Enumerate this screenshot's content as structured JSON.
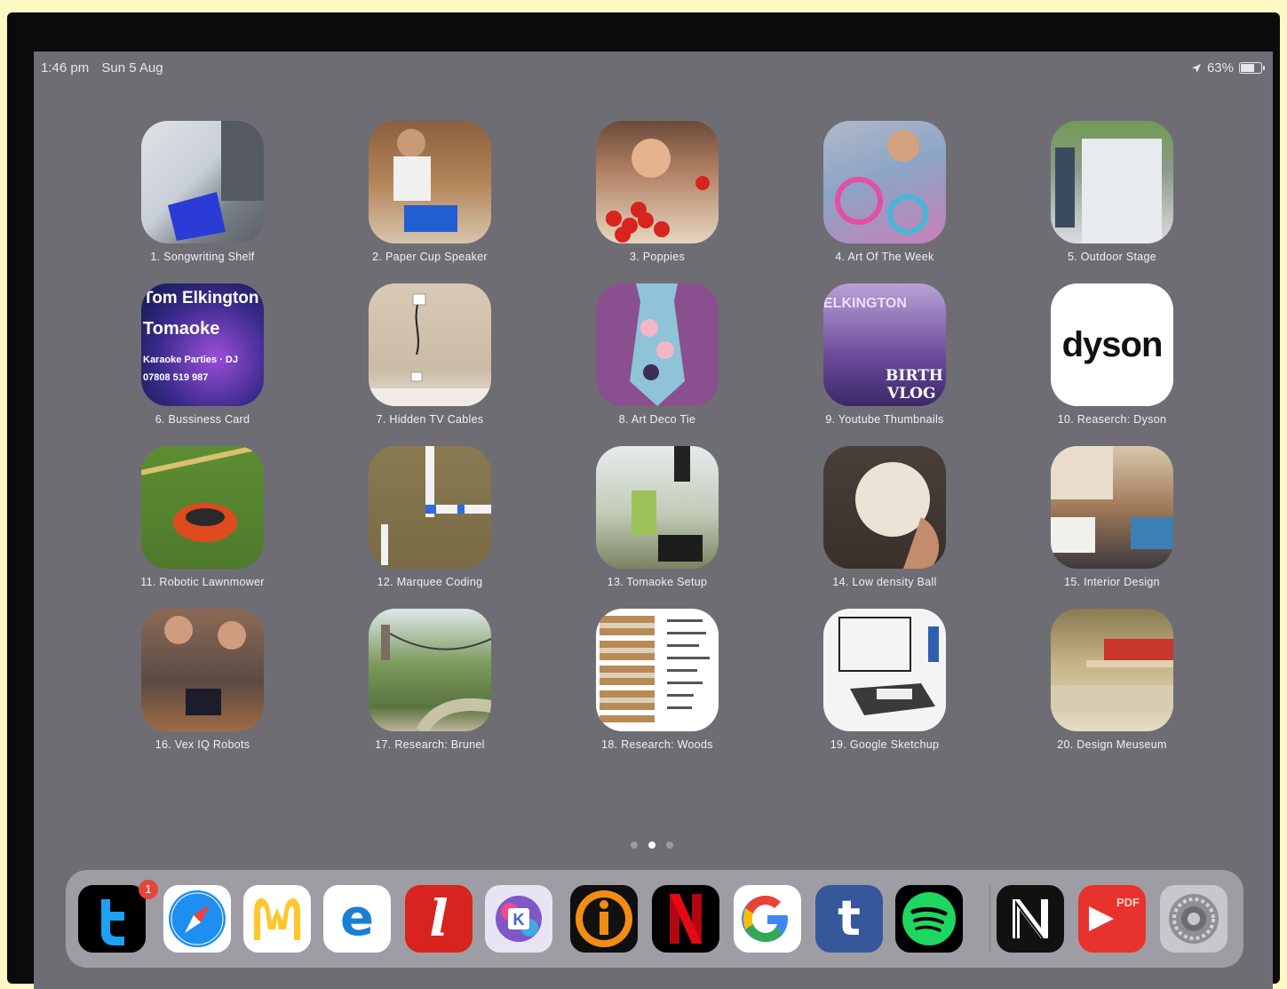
{
  "status_bar": {
    "time": "1:46 pm",
    "date": "Sun 5 Aug",
    "battery_text": "63%",
    "battery_level": 0.63
  },
  "apps": [
    {
      "label": "1. Songwriting Shelf",
      "icon": "songwriting-shelf-photo"
    },
    {
      "label": "2. Paper Cup Speaker",
      "icon": "paper-cup-speaker-photo"
    },
    {
      "label": "3. Poppies",
      "icon": "poppies-photo"
    },
    {
      "label": "4. Art Of The Week",
      "icon": "art-of-the-week-photo"
    },
    {
      "label": "5. Outdoor Stage",
      "icon": "outdoor-stage-photo"
    },
    {
      "label": "6. Bussiness Card",
      "icon": "business-card-image",
      "card_lines": [
        "Tom Elkington",
        "Tomaoke",
        "Karaoke Parties · DJ",
        "07808 519 987"
      ]
    },
    {
      "label": "7. Hidden TV Cables",
      "icon": "hidden-tv-cables-photo"
    },
    {
      "label": "8. Art Deco Tie",
      "icon": "art-deco-tie-image"
    },
    {
      "label": "9. Youtube Thumbnails",
      "icon": "youtube-thumbnail-image",
      "thumb_lines": [
        "ELKINGTON",
        "BIRTH",
        "VLOG"
      ]
    },
    {
      "label": "10. Reaserch: Dyson",
      "icon": "dyson-logo",
      "logo_text": "dyson"
    },
    {
      "label": "11. Robotic Lawnmower",
      "icon": "robotic-lawnmower-photo"
    },
    {
      "label": "12. Marquee Coding",
      "icon": "marquee-coding-photo"
    },
    {
      "label": "13. Tomaoke Setup",
      "icon": "tomaoke-setup-photo"
    },
    {
      "label": "14. Low density Ball",
      "icon": "low-density-ball-photo"
    },
    {
      "label": "15. Interior Design",
      "icon": "interior-design-photo"
    },
    {
      "label": "16. Vex IQ Robots",
      "icon": "vex-iq-robots-photo"
    },
    {
      "label": "17. Research: Brunel",
      "icon": "brunel-bridge-photo"
    },
    {
      "label": "18. Research: Woods",
      "icon": "wood-layers-diagram"
    },
    {
      "label": "19. Google Sketchup",
      "icon": "sketchup-render-image"
    },
    {
      "label": "20. Design Meuseum",
      "icon": "design-museum-photo"
    }
  ],
  "page_dots": {
    "count": 3,
    "active": 1
  },
  "dock": {
    "apps": [
      {
        "name": "twitter-app",
        "glyph": "t",
        "bg": "#000000",
        "fg": "#1da1f2",
        "badge": "1"
      },
      {
        "name": "safari-app",
        "glyph": "",
        "bg": "#ffffff",
        "fg": "#1f8ef1"
      },
      {
        "name": "mcdonalds-app",
        "glyph": "M",
        "bg": "#ffffff",
        "fg": "#ffc72c"
      },
      {
        "name": "edge-app",
        "glyph": "e",
        "bg": "#ffffff",
        "fg": "#1b7ed6"
      },
      {
        "name": "scribble-app",
        "glyph": "l",
        "bg": "#d8231f",
        "fg": "#ffffff"
      },
      {
        "name": "krita-app",
        "glyph": "K",
        "bg": "#e9e4f4",
        "fg": "#3b66c4"
      },
      {
        "name": "incredibles-app",
        "glyph": "i",
        "bg": "#0f0f0f",
        "fg": "#f28c12"
      },
      {
        "name": "netflix-app",
        "glyph": "N",
        "bg": "#000000",
        "fg": "#e50914"
      },
      {
        "name": "google-app",
        "glyph": "G",
        "bg": "#ffffff",
        "fg": "#4285f4"
      },
      {
        "name": "tumblr-app",
        "glyph": "t",
        "bg": "#36589a",
        "fg": "#ffffff"
      },
      {
        "name": "spotify-app",
        "glyph": "",
        "bg": "#000000",
        "fg": "#1ed760"
      },
      {
        "name": "nespresso-app",
        "glyph": "N",
        "bg": "#111111",
        "fg": "#ffffff"
      },
      {
        "name": "pdf-expert-app",
        "glyph": "PDF",
        "bg": "#e8322d",
        "fg": "#ffffff"
      },
      {
        "name": "settings-app",
        "glyph": "",
        "bg": "#c7c7cc",
        "fg": "#6c6c72"
      }
    ]
  }
}
